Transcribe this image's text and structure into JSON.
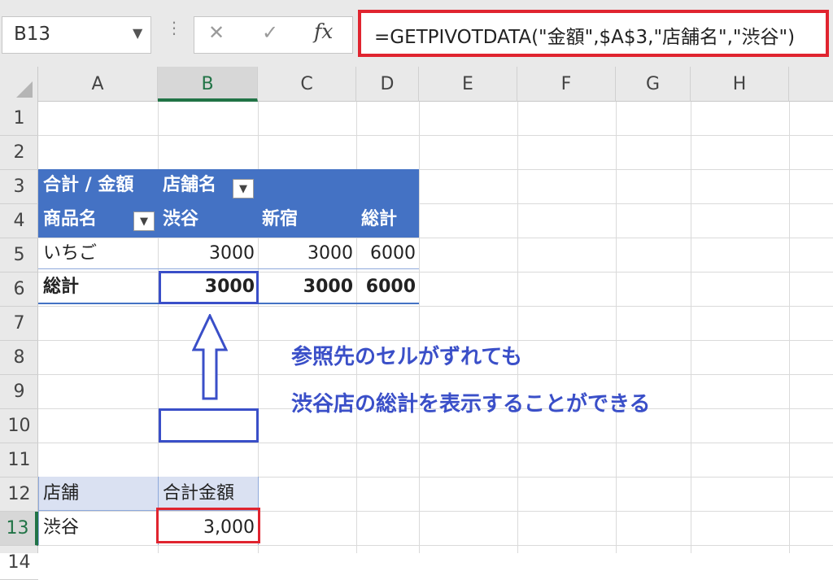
{
  "namebox": {
    "value": "B13"
  },
  "formula_bar": {
    "fx": "fx",
    "formula": "=GETPIVOTDATA(\"金額\",$A$3,\"店舗名\",\"渋谷\")"
  },
  "columns": [
    "A",
    "B",
    "C",
    "D",
    "E",
    "F",
    "G",
    "H"
  ],
  "rows": [
    "1",
    "2",
    "3",
    "4",
    "5",
    "6",
    "7",
    "8",
    "9",
    "10",
    "11",
    "12",
    "13",
    "14"
  ],
  "pivot": {
    "corner_label": "合計 / 金額",
    "col_field": "店舗名",
    "row_field": "商品名",
    "col_headers": [
      "渋谷",
      "新宿",
      "総計"
    ],
    "data_row": {
      "label": "いちご",
      "values": [
        "3000",
        "3000",
        "6000"
      ]
    },
    "total_row": {
      "label": "総計",
      "values": [
        "3000",
        "3000",
        "6000"
      ]
    }
  },
  "lookup": {
    "header": [
      "店舗",
      "合計金額"
    ],
    "row": [
      "渋谷",
      "3,000"
    ]
  },
  "callout": {
    "line1": "参照先のセルがずれても",
    "line2": "渋谷店の総計を表示することができる"
  }
}
